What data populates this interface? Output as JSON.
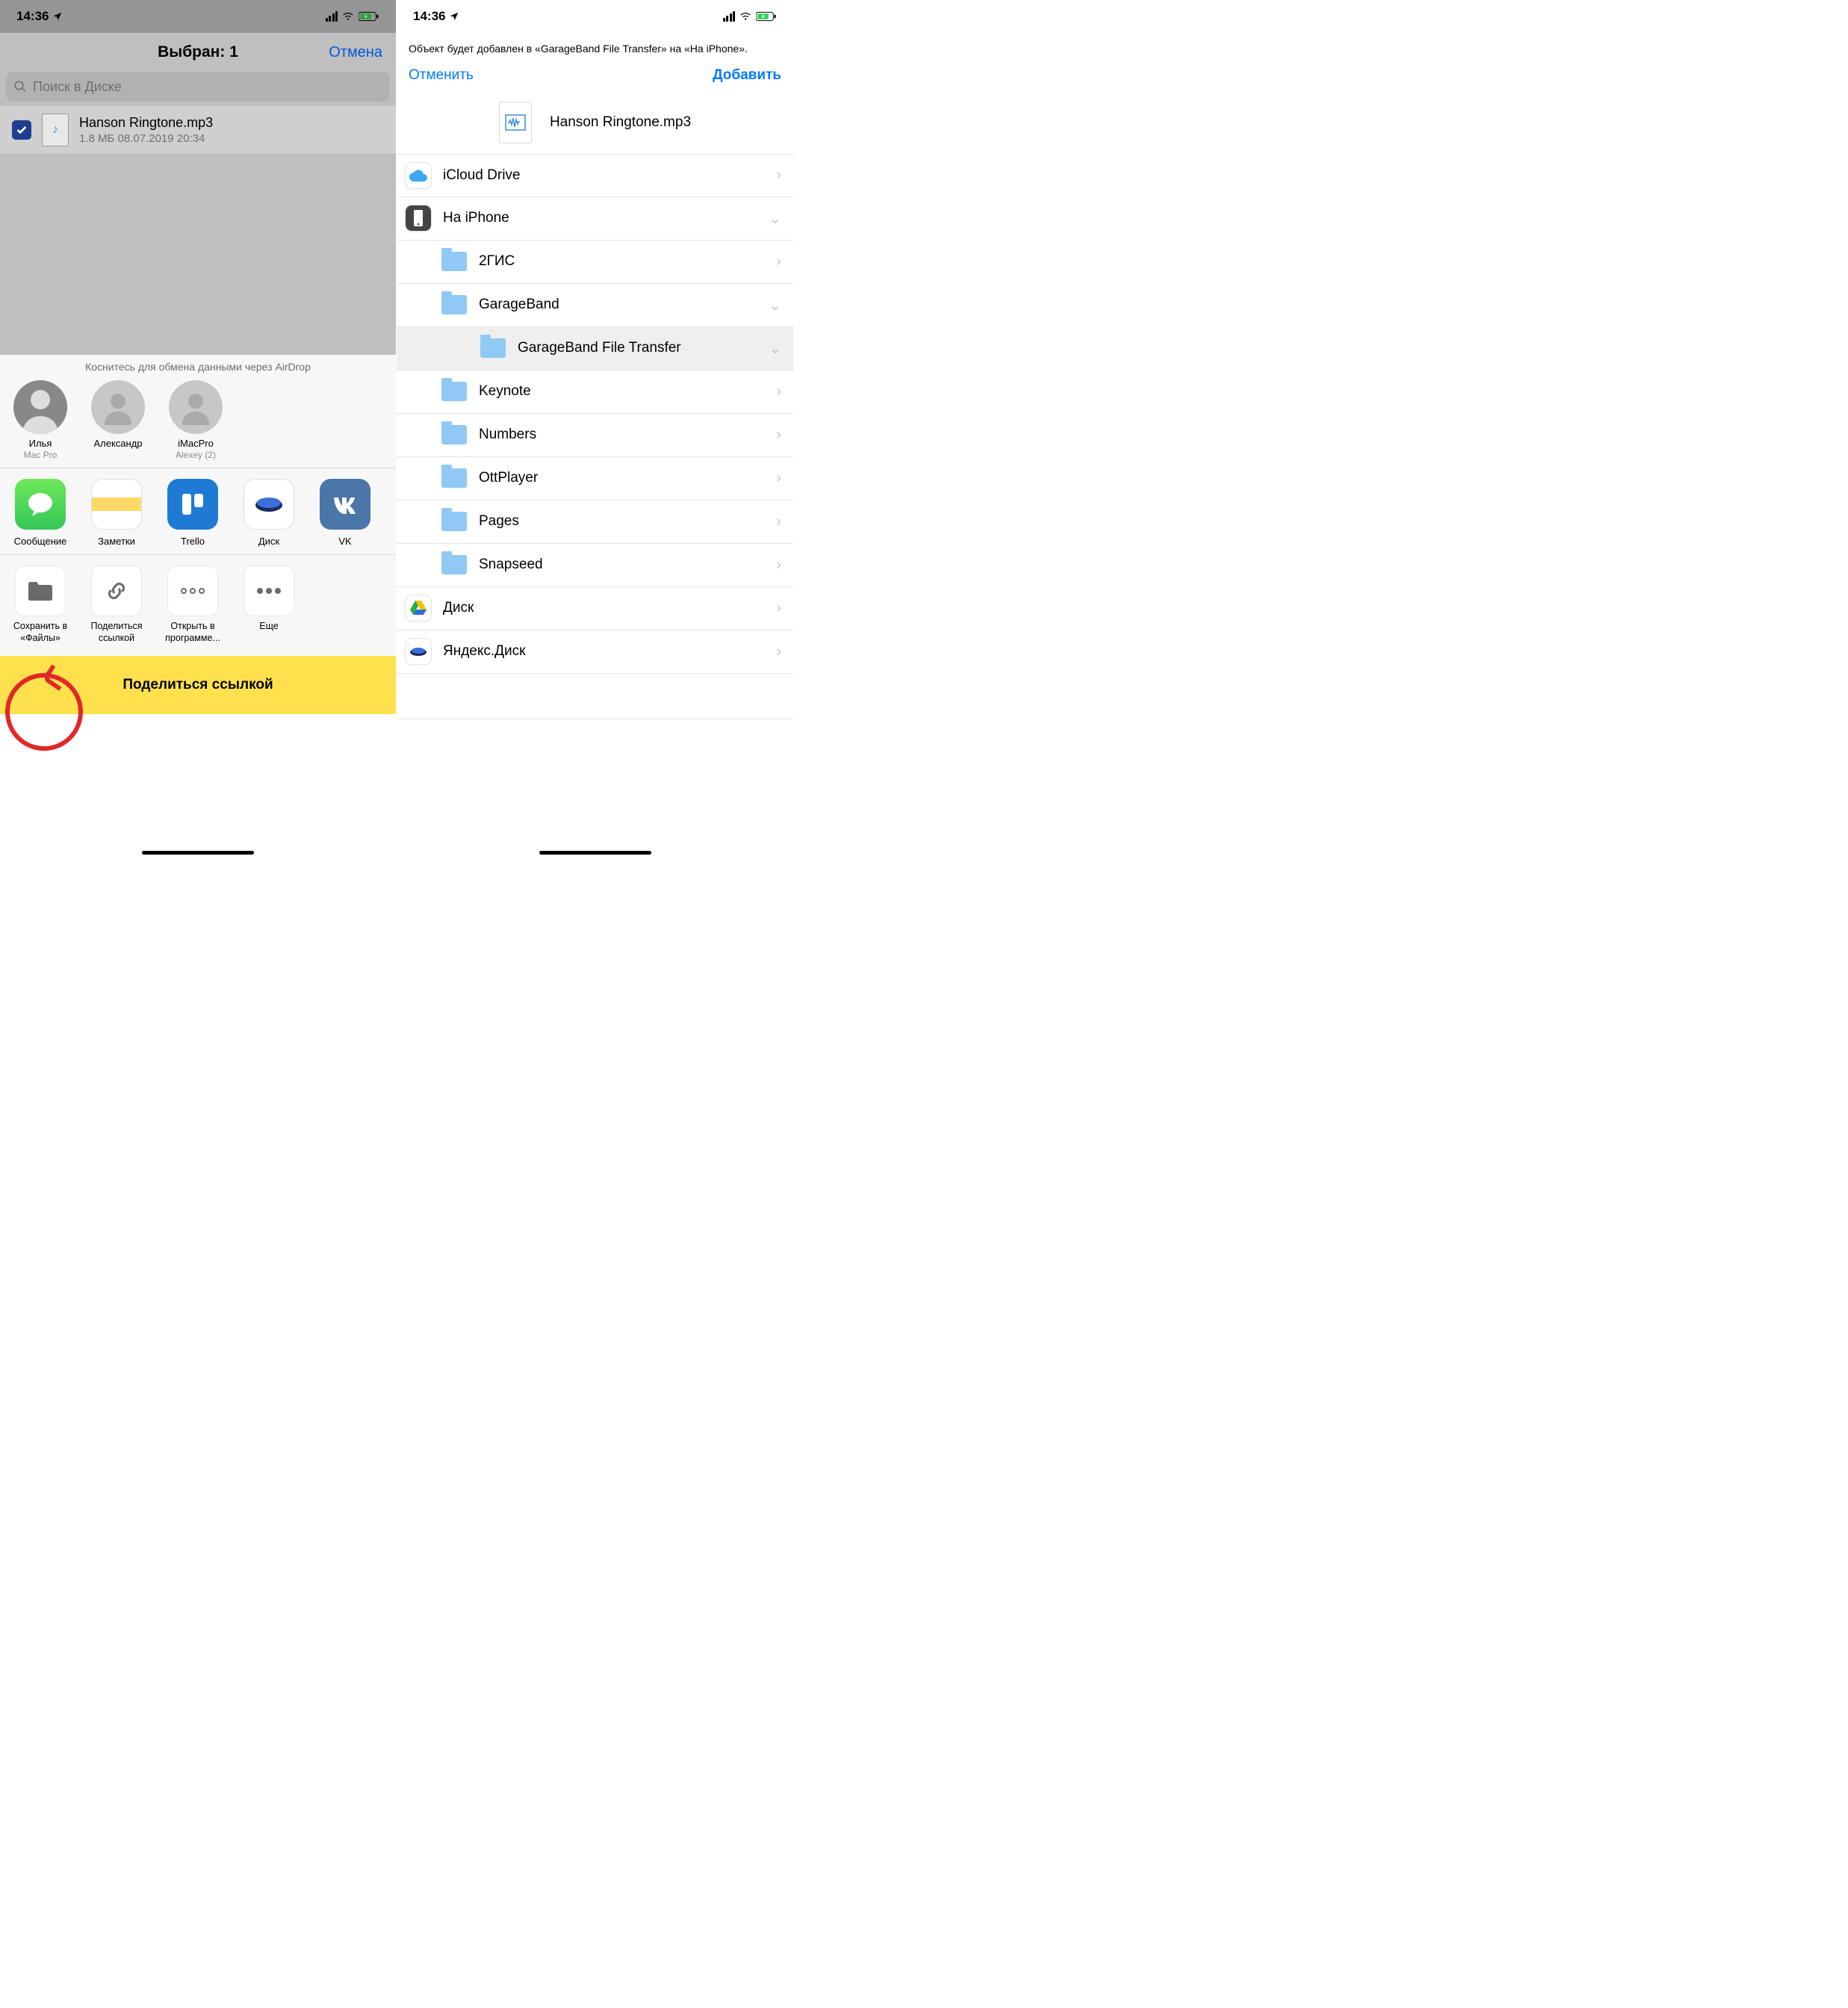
{
  "status": {
    "time": "14:36"
  },
  "left": {
    "title": "Выбран: 1",
    "cancel": "Отмена",
    "search_placeholder": "Поиск в Диске",
    "file": {
      "name": "Hanson Ringtone.mp3",
      "meta": "1.8 МБ   08.07.2019 20:34"
    },
    "airdrop_hint": "Коснитесь для обмена данными через AirDrop",
    "airdrop": [
      {
        "name": "Илья",
        "sub": "Mac Pro"
      },
      {
        "name": "Александр",
        "sub": ""
      },
      {
        "name": "iMacPro",
        "sub": "Alexey (2)"
      }
    ],
    "apps": [
      {
        "label": "Сообщение"
      },
      {
        "label": "Заметки"
      },
      {
        "label": "Trello"
      },
      {
        "label": "Диск"
      },
      {
        "label": "VK"
      }
    ],
    "actions": [
      {
        "label": "Сохранить в «Файлы»"
      },
      {
        "label": "Поделиться ссылкой"
      },
      {
        "label": "Открыть в программе..."
      },
      {
        "label": "Еще"
      }
    ],
    "share_link": "Поделиться ссылкой"
  },
  "right": {
    "notice": "Объект будет добавлен в «GarageBand File Transfer» на «На iPhone».",
    "cancel": "Отменить",
    "add": "Добавить",
    "file_name": "Hanson Ringtone.mp3",
    "locations": {
      "icloud": "iCloud Drive",
      "on_iphone": "На iPhone",
      "folders": [
        {
          "label": "2ГИС",
          "chev": "right"
        },
        {
          "label": "GarageBand",
          "chev": "down"
        },
        {
          "label": "GarageBand File Transfer",
          "chev": "down",
          "selected": true,
          "indent": 2
        },
        {
          "label": "Keynote",
          "chev": "right"
        },
        {
          "label": "Numbers",
          "chev": "right"
        },
        {
          "label": "OttPlayer",
          "chev": "right"
        },
        {
          "label": "Pages",
          "chev": "right"
        },
        {
          "label": "Snapseed",
          "chev": "right"
        }
      ],
      "gdrive": "Диск",
      "yadisk": "Яндекс.Диск"
    }
  }
}
